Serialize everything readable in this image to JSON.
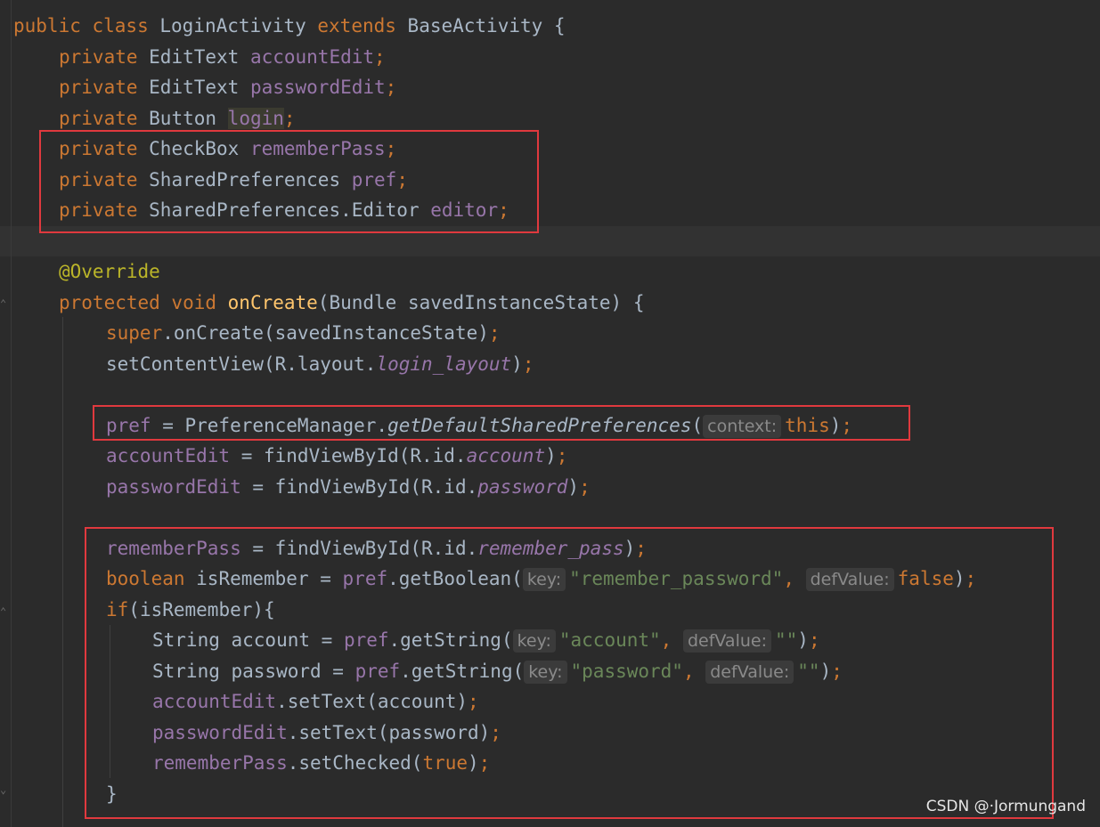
{
  "lines": [
    {
      "id": "l1",
      "tokens": [
        {
          "t": "public class ",
          "c": "kw"
        },
        {
          "t": "LoginActivity ",
          "c": ""
        },
        {
          "t": "extends ",
          "c": "kw"
        },
        {
          "t": "BaseActivity {",
          "c": ""
        }
      ]
    },
    {
      "id": "l2",
      "tokens": [
        {
          "t": "private ",
          "c": "kw"
        },
        {
          "t": "EditText ",
          "c": ""
        },
        {
          "t": "accountEdit",
          "c": "fld"
        },
        {
          "t": ";",
          "c": "kw"
        }
      ]
    },
    {
      "id": "l3",
      "tokens": [
        {
          "t": "private ",
          "c": "kw"
        },
        {
          "t": "EditText ",
          "c": ""
        },
        {
          "t": "passwordEdit",
          "c": "fld"
        },
        {
          "t": ";",
          "c": "kw"
        }
      ]
    },
    {
      "id": "l4",
      "tokens": [
        {
          "t": "private ",
          "c": "kw"
        },
        {
          "t": "Button ",
          "c": ""
        },
        {
          "t": "login",
          "c": "fld hl"
        },
        {
          "t": ";",
          "c": "kw"
        }
      ]
    },
    {
      "id": "l5",
      "tokens": [
        {
          "t": "private ",
          "c": "kw"
        },
        {
          "t": "CheckBox ",
          "c": ""
        },
        {
          "t": "rememberPass",
          "c": "fld"
        },
        {
          "t": ";",
          "c": "kw"
        }
      ]
    },
    {
      "id": "l6",
      "tokens": [
        {
          "t": "private ",
          "c": "kw"
        },
        {
          "t": "SharedPreferences ",
          "c": ""
        },
        {
          "t": "pref",
          "c": "fld"
        },
        {
          "t": ";",
          "c": "kw"
        }
      ]
    },
    {
      "id": "l7",
      "tokens": [
        {
          "t": "private ",
          "c": "kw"
        },
        {
          "t": "SharedPreferences.Editor ",
          "c": ""
        },
        {
          "t": "editor",
          "c": "fld"
        },
        {
          "t": ";",
          "c": "kw"
        }
      ]
    },
    {
      "id": "l8",
      "tokens": []
    },
    {
      "id": "l9",
      "tokens": [
        {
          "t": "@Override",
          "c": "an"
        }
      ]
    },
    {
      "id": "l10",
      "tokens": [
        {
          "t": "protected void ",
          "c": "kw"
        },
        {
          "t": "onCreate",
          "c": "fn"
        },
        {
          "t": "(Bundle savedInstanceState) {",
          "c": ""
        }
      ]
    },
    {
      "id": "l11",
      "tokens": [
        {
          "t": "super",
          "c": "kw"
        },
        {
          "t": ".onCreate(savedInstanceState)",
          "c": ""
        },
        {
          "t": ";",
          "c": "kw"
        }
      ]
    },
    {
      "id": "l12",
      "tokens": [
        {
          "t": "setContentView(R.layout.",
          "c": ""
        },
        {
          "t": "login_layout",
          "c": "fi"
        },
        {
          "t": ")",
          "c": ""
        },
        {
          "t": ";",
          "c": "kw"
        }
      ]
    },
    {
      "id": "l13",
      "tokens": []
    },
    {
      "id": "l14",
      "tokens": [
        {
          "t": "pref ",
          "c": "fld"
        },
        {
          "t": "= PreferenceManager.",
          "c": ""
        },
        {
          "t": "getDefaultSharedPreferences",
          "c": "st"
        },
        {
          "t": "(",
          "c": ""
        },
        {
          "t": "context:",
          "c": "hint"
        },
        {
          "t": "this",
          "c": "kw"
        },
        {
          "t": ")",
          "c": ""
        },
        {
          "t": ";",
          "c": "kw"
        }
      ]
    },
    {
      "id": "l15",
      "tokens": [
        {
          "t": "accountEdit ",
          "c": "fld"
        },
        {
          "t": "= findViewById(R.id.",
          "c": ""
        },
        {
          "t": "account",
          "c": "fi"
        },
        {
          "t": ")",
          "c": ""
        },
        {
          "t": ";",
          "c": "kw"
        }
      ]
    },
    {
      "id": "l16",
      "tokens": [
        {
          "t": "passwordEdit ",
          "c": "fld"
        },
        {
          "t": "= findViewById(R.id.",
          "c": ""
        },
        {
          "t": "password",
          "c": "fi"
        },
        {
          "t": ")",
          "c": ""
        },
        {
          "t": ";",
          "c": "kw"
        }
      ]
    },
    {
      "id": "l17",
      "tokens": []
    },
    {
      "id": "l18",
      "tokens": [
        {
          "t": "rememberPass ",
          "c": "fld"
        },
        {
          "t": "= findViewById(R.id.",
          "c": ""
        },
        {
          "t": "remember_pass",
          "c": "fi"
        },
        {
          "t": ")",
          "c": ""
        },
        {
          "t": ";",
          "c": "kw"
        }
      ]
    },
    {
      "id": "l19",
      "tokens": [
        {
          "t": "boolean ",
          "c": "kw"
        },
        {
          "t": "isRemember = ",
          "c": ""
        },
        {
          "t": "pref",
          "c": "fld"
        },
        {
          "t": ".getBoolean(",
          "c": ""
        },
        {
          "t": "key:",
          "c": "hint"
        },
        {
          "t": "\"remember_password\"",
          "c": "str"
        },
        {
          "t": ", ",
          "c": "kw"
        },
        {
          "t": "defValue:",
          "c": "hint"
        },
        {
          "t": "false",
          "c": "kw"
        },
        {
          "t": ")",
          "c": ""
        },
        {
          "t": ";",
          "c": "kw"
        }
      ]
    },
    {
      "id": "l20",
      "tokens": [
        {
          "t": "if",
          "c": "kw"
        },
        {
          "t": "(isRemember){",
          "c": ""
        }
      ]
    },
    {
      "id": "l21",
      "tokens": [
        {
          "t": "String account = ",
          "c": ""
        },
        {
          "t": "pref",
          "c": "fld"
        },
        {
          "t": ".getString(",
          "c": ""
        },
        {
          "t": "key:",
          "c": "hint"
        },
        {
          "t": "\"account\"",
          "c": "str"
        },
        {
          "t": ", ",
          "c": "kw"
        },
        {
          "t": "defValue:",
          "c": "hint"
        },
        {
          "t": "\"\"",
          "c": "str"
        },
        {
          "t": ")",
          "c": ""
        },
        {
          "t": ";",
          "c": "kw"
        }
      ]
    },
    {
      "id": "l22",
      "tokens": [
        {
          "t": "String password = ",
          "c": ""
        },
        {
          "t": "pref",
          "c": "fld"
        },
        {
          "t": ".getString(",
          "c": ""
        },
        {
          "t": "key:",
          "c": "hint"
        },
        {
          "t": "\"password\"",
          "c": "str"
        },
        {
          "t": ", ",
          "c": "kw"
        },
        {
          "t": "defValue:",
          "c": "hint"
        },
        {
          "t": "\"\"",
          "c": "str"
        },
        {
          "t": ")",
          "c": ""
        },
        {
          "t": ";",
          "c": "kw"
        }
      ]
    },
    {
      "id": "l23",
      "tokens": [
        {
          "t": "accountEdit",
          "c": "fld"
        },
        {
          "t": ".setText(account)",
          "c": ""
        },
        {
          "t": ";",
          "c": "kw"
        }
      ]
    },
    {
      "id": "l24",
      "tokens": [
        {
          "t": "passwordEdit",
          "c": "fld"
        },
        {
          "t": ".setText(password)",
          "c": ""
        },
        {
          "t": ";",
          "c": "kw"
        }
      ]
    },
    {
      "id": "l25",
      "tokens": [
        {
          "t": "rememberPass",
          "c": "fld"
        },
        {
          "t": ".setChecked(",
          "c": ""
        },
        {
          "t": "true",
          "c": "kw"
        },
        {
          "t": ")",
          "c": ""
        },
        {
          "t": ";",
          "c": "kw"
        }
      ]
    },
    {
      "id": "l26",
      "tokens": [
        {
          "t": "}",
          "c": ""
        }
      ]
    }
  ],
  "annotation_color": "#e0393e",
  "theme": {
    "background": "#2b2b2b",
    "keyword": "#cc7832",
    "field": "#9876aa",
    "method": "#ffc66d",
    "annotation": "#bbb529",
    "string": "#6a8759"
  },
  "watermark": "CSDN @·Jormungand"
}
